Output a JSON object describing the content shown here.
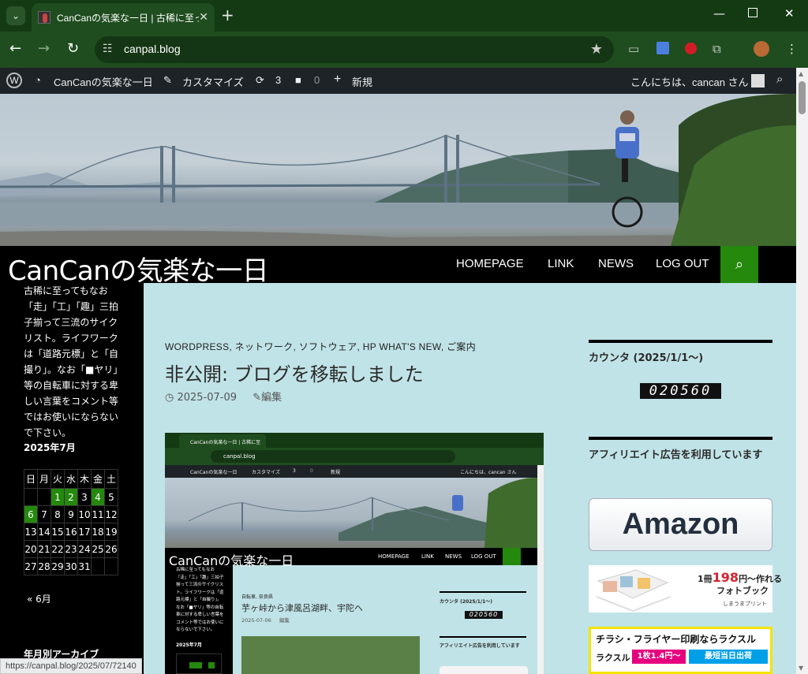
{
  "browser": {
    "tab_title": "CanCanの気楽な一日 | 古稀に至っても",
    "url": "canpal.blog",
    "status_url": "https://canpal.blog/2025/07/72140"
  },
  "adminbar": {
    "site_name": "CanCanの気楽な一日",
    "customize": "カスタマイズ",
    "updates": "3",
    "comments": "0",
    "new": "新規",
    "greeting": "こんにちは、cancan さん"
  },
  "site": {
    "title": "CanCanの気楽な一日",
    "nav": [
      "HOMEPAGE",
      "LINK",
      "NEWS",
      "LOG OUT"
    ]
  },
  "sidebar": {
    "description": "古稀に至ってもなお「走」「工」「趣」三拍子揃って三流のサイクリスト。ライフワークは「道路元標」と「自撮り」。なお「■ヤリ」等の自転車に対する卑しい言葉をコメント等ではお使いにならないで下さい。",
    "calendar_title": "2025年7月",
    "weekdays": [
      "日",
      "月",
      "火",
      "水",
      "木",
      "金",
      "土"
    ],
    "weeks": [
      [
        "",
        "",
        "1",
        "2",
        "3",
        "4",
        "5"
      ],
      [
        "6",
        "7",
        "8",
        "9",
        "10",
        "11",
        "12"
      ],
      [
        "13",
        "14",
        "15",
        "16",
        "17",
        "18",
        "19"
      ],
      [
        "20",
        "21",
        "22",
        "23",
        "24",
        "25",
        "26"
      ],
      [
        "27",
        "28",
        "29",
        "30",
        "31",
        "",
        ""
      ]
    ],
    "linked_days": [
      "1",
      "2",
      "4",
      "6"
    ],
    "prev_month": "« 6月",
    "archive_title": "年月別アーカイブ"
  },
  "post": {
    "categories": "WORDPRESS, ネットワーク, ソフトウェア, HP WHAT'S NEW, ご案内",
    "title": "非公開: ブログを移転しました",
    "date": "2025-07-09",
    "edit": "編集"
  },
  "inner": {
    "tab_title": "CanCanの気楽な一日 | 古稀に至",
    "url": "canpal.blog",
    "admin_site": "CanCanの気楽な一日",
    "admin_customize": "カスタマイズ",
    "admin_updates": "3",
    "admin_comments": "0",
    "admin_new": "新規",
    "admin_greeting": "こんにちは、cancan さん",
    "site_title": "CanCanの気楽な一日",
    "nav": [
      "HOMEPAGE",
      "LINK",
      "NEWS",
      "LOG OUT"
    ],
    "description": "古稀に至ってもなお「走」「工」「趣」三拍子揃って三流のサイクリスト。ライフワークは「道路元標」と「自撮り」。なお「■ヤリ」等の自転車に対する卑しい言葉をコメント等ではお使いにならないで下さい。",
    "calendar_title": "2025年7月",
    "post_categories": "自転車, 奈良県",
    "post_title": "芋ヶ峠から津風呂湖畔、宇陀へ",
    "post_date": "2025-07-06",
    "post_edit": "編集",
    "widget_counter": "カウンタ (2025/1/1〜)",
    "counter": "020560",
    "widget_affiliate": "アフィリエイト広告を利用しています"
  },
  "widgets": {
    "counter_title": "カウンタ (2025/1/1〜)",
    "counter_value": "020560",
    "affiliate_title": "アフィリエイト広告を利用しています",
    "amazon": "Amazon",
    "photo_ad_line1": "1冊",
    "photo_ad_price": "198",
    "photo_ad_line1b": "円〜作れる",
    "photo_ad_line2": "フォトブック",
    "photo_ad_brand": "しまうまプリント",
    "rakus_line1": "チラシ・フライヤー印刷ならラクスル",
    "rakus_brand": "ラクスル",
    "rakus_price": "1枚1.4円〜",
    "rakus_badge": "最短当日出荷"
  },
  "colors": {
    "chrome_tabbar": "#143a14",
    "chrome_toolbar": "#1f4d1f",
    "accent_green": "#24890d",
    "content_bg": "#c0e3e7"
  }
}
